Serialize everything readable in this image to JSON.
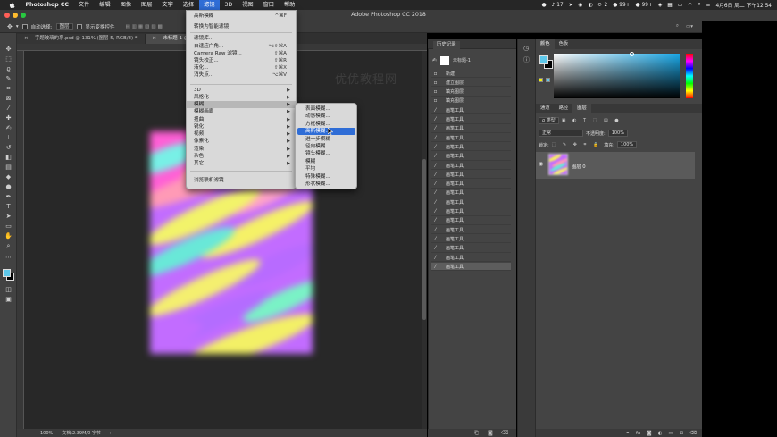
{
  "menubar": {
    "app_name": "Photoshop CC",
    "items": [
      "文件",
      "编辑",
      "图像",
      "图层",
      "文字",
      "选择",
      "滤镜",
      "3D",
      "视图",
      "窗口",
      "帮助"
    ],
    "active_index": 6,
    "tray": {
      "notif_count": "17",
      "badge_a": "2",
      "badge_b": "99+",
      "badge_c": "99+",
      "datetime": "4月6日 周二 下午12:54"
    }
  },
  "window": {
    "title": "Adobe Photoshop CC 2018"
  },
  "options_bar": {
    "auto_select_label": "自动选择:",
    "auto_select_value": "图层",
    "show_transform_label": "显示变换控件"
  },
  "tabs": [
    {
      "label": "字题玻璃的系.psd @ 131% (图层 5, RGB/8) *",
      "active": false
    },
    {
      "label": "未标题-1 @ 66.7% (图层 0, RGB/8#) *",
      "active": true
    }
  ],
  "canvas": {
    "watermark": "优优教程网",
    "zoom": "100%",
    "doc_info": "文档:2.39M/0 字节"
  },
  "filter_menu": {
    "items": [
      {
        "label": "高斯模糊",
        "shortcut": "^⌘F",
        "submenu": false
      },
      {
        "label": "转换为智能滤镜",
        "shortcut": "",
        "submenu": false
      },
      {
        "label": "滤镜库...",
        "shortcut": "",
        "submenu": false
      },
      {
        "label": "自适应广角...",
        "shortcut": "⌥⇧⌘A",
        "submenu": false
      },
      {
        "label": "Camera Raw 滤镜...",
        "shortcut": "⇧⌘A",
        "submenu": false
      },
      {
        "label": "镜头校正...",
        "shortcut": "⇧⌘R",
        "submenu": false
      },
      {
        "label": "液化...",
        "shortcut": "⇧⌘X",
        "submenu": false
      },
      {
        "label": "消失点...",
        "shortcut": "⌥⌘V",
        "submenu": false
      },
      {
        "label": "3D",
        "shortcut": "",
        "submenu": true
      },
      {
        "label": "风格化",
        "shortcut": "",
        "submenu": true
      },
      {
        "label": "模糊",
        "shortcut": "",
        "submenu": true
      },
      {
        "label": "模糊画廊",
        "shortcut": "",
        "submenu": true
      },
      {
        "label": "扭曲",
        "shortcut": "",
        "submenu": true
      },
      {
        "label": "锐化",
        "shortcut": "",
        "submenu": true
      },
      {
        "label": "视频",
        "shortcut": "",
        "submenu": true
      },
      {
        "label": "像素化",
        "shortcut": "",
        "submenu": true
      },
      {
        "label": "渲染",
        "shortcut": "",
        "submenu": true
      },
      {
        "label": "杂色",
        "shortcut": "",
        "submenu": true
      },
      {
        "label": "其它",
        "shortcut": "",
        "submenu": true
      },
      {
        "label": "浏览联机滤镜...",
        "shortcut": "",
        "submenu": false
      }
    ]
  },
  "blur_submenu": {
    "items": [
      "表面模糊...",
      "动感模糊...",
      "方框模糊...",
      "高斯模糊...",
      "进一步模糊",
      "径向模糊...",
      "镜头模糊...",
      "模糊",
      "平均",
      "特殊模糊...",
      "形状模糊..."
    ],
    "highlighted_index": 3
  },
  "history": {
    "title": "历史记录",
    "snapshot": "未标题-1",
    "items": [
      "新建",
      "建立图层",
      "填充图层",
      "填充图层",
      "画笔工具",
      "画笔工具",
      "画笔工具",
      "画笔工具",
      "画笔工具",
      "画笔工具",
      "画笔工具",
      "画笔工具",
      "画笔工具",
      "画笔工具",
      "画笔工具",
      "画笔工具",
      "画笔工具",
      "画笔工具",
      "画笔工具",
      "画笔工具",
      "画笔工具",
      "画笔工具"
    ],
    "selected_index": 21
  },
  "color_panel": {
    "tabs": [
      "颜色",
      "色板"
    ],
    "foreground": "#5ec8ea",
    "background": "#000000"
  },
  "layers_panel": {
    "tabs": [
      "通道",
      "路径",
      "图层"
    ],
    "kind_label": "ρ 类型",
    "blend_mode": "正常",
    "opacity_label": "不透明度:",
    "opacity_value": "100%",
    "lock_label": "锁定:",
    "fill_label": "填充:",
    "fill_value": "100%",
    "layer_name": "图层 0"
  },
  "colors": {
    "menu_highlight": "#2f6dd6",
    "panel_bg": "#444444",
    "canvas_bg": "#282828"
  }
}
